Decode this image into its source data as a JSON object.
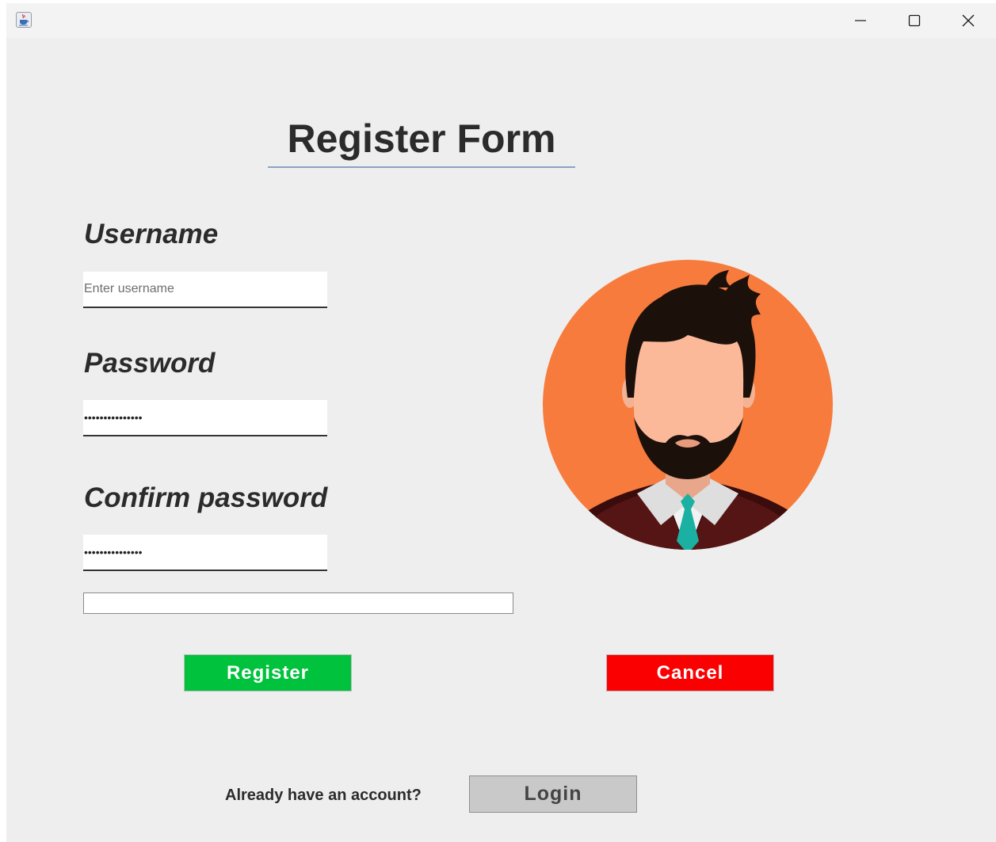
{
  "form": {
    "title": "Register Form",
    "username_label": "Username",
    "username_placeholder": "Enter username",
    "username_value": "",
    "password_label": "Password",
    "password_value": "•••••••••••••••",
    "confirm_label": "Confirm password",
    "confirm_value": "•••••••••••••••",
    "progress": 0
  },
  "buttons": {
    "register": "Register",
    "cancel": "Cancel"
  },
  "footer": {
    "already_text": "Already have an account?",
    "login": "Login"
  },
  "colors": {
    "register": "#00c23c",
    "cancel": "#fb0000",
    "avatar_bg": "#f77b3c",
    "tie": "#1bb1a2"
  },
  "icons": {
    "app": "java-cup-icon",
    "minimize": "minimize-icon",
    "maximize": "maximize-icon",
    "close": "close-icon",
    "avatar": "bearded-man-avatar"
  }
}
